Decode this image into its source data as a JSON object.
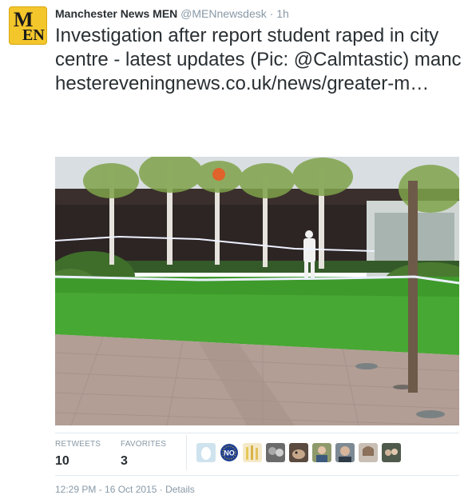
{
  "tweet": {
    "author_name": "Manchester News MEN",
    "author_handle": "@MENnewsdesk",
    "separator": "·",
    "time_ago": "1h",
    "avatar_text_top": "M",
    "avatar_text_bottom": "EN",
    "text": "Investigation after report student raped in city centre - latest updates (Pic: @Calmtastic)",
    "link": "manchestereveningnews.co.uk/news/greater-m…"
  },
  "stats": {
    "retweets_label": "RETWEETS",
    "retweets_value": "10",
    "favorites_label": "FAVORITES",
    "favorites_value": "3"
  },
  "favoriters": [
    {
      "icon": "egg-avatar"
    },
    {
      "icon": "no-badge-avatar",
      "text": "NO"
    },
    {
      "icon": "bottles-avatar"
    },
    {
      "icon": "people-avatar"
    },
    {
      "icon": "dog-avatar"
    },
    {
      "icon": "person-avatar"
    },
    {
      "icon": "man-avatar"
    },
    {
      "icon": "woman-avatar"
    },
    {
      "icon": "group-avatar"
    }
  ],
  "footer": {
    "timestamp": "12:29 PM - 16 Oct 2015",
    "separator": "·",
    "details_link": "Details"
  },
  "colors": {
    "text": "#292f33",
    "muted": "#8899a6",
    "border": "#e1e8ed",
    "avatar_bg": "#f3c62b"
  }
}
